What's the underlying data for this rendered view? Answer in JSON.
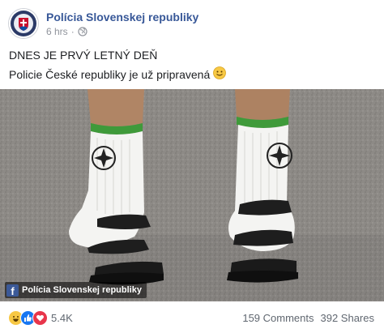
{
  "post": {
    "page_name": "Polícia Slovenskej republiky",
    "time": "6 hrs",
    "separator": "·",
    "audience_icon": "globe-icon",
    "text_line1": "DNES JE PRVÝ LETNÝ DEŇ",
    "text_line2": "Policie České republiky je už pripravená",
    "emoji": "slightly-smiling-face"
  },
  "image": {
    "description_icon": "photo-feet-socks-sandals",
    "watermark_logo": "f",
    "watermark_text": "Polícia Slovenskej republiky"
  },
  "footer": {
    "reactions": [
      "haha",
      "like",
      "love"
    ],
    "reaction_count": "5.4K",
    "comments": "159 Comments",
    "shares": "392 Shares"
  },
  "colors": {
    "link_blue": "#385898",
    "meta_gray": "#90949c",
    "sock_green": "#3f9a3a",
    "like_blue": "#1877f2",
    "love_red": "#e8364b",
    "haha_yellow": "#f7c844"
  }
}
